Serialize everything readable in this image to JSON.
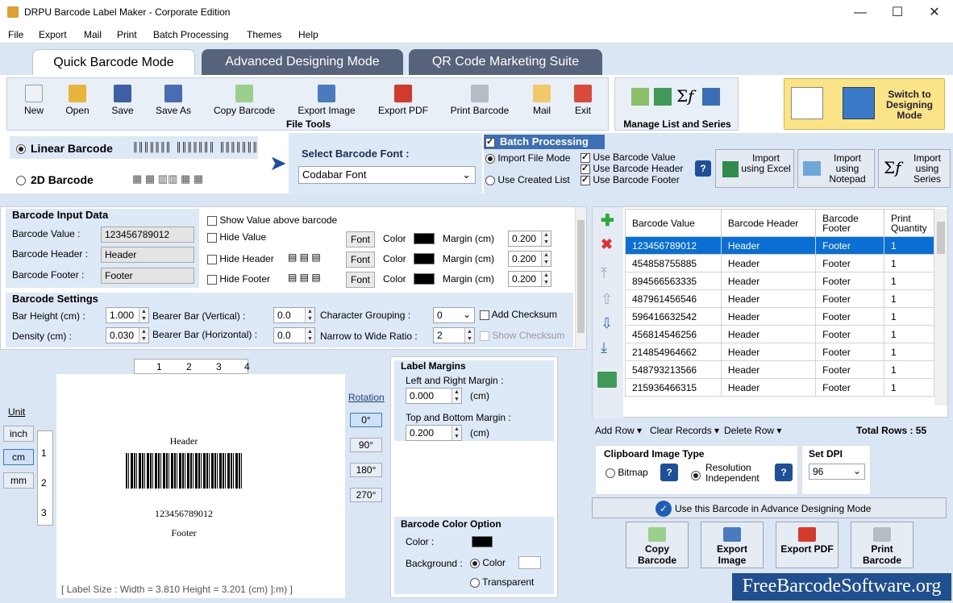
{
  "window": {
    "title": "DRPU Barcode Label Maker - Corporate Edition",
    "min": "—",
    "max": "☐",
    "close": "✕"
  },
  "menu": [
    "File",
    "Export",
    "Mail",
    "Print",
    "Batch Processing",
    "Themes",
    "Help"
  ],
  "tabs": [
    "Quick Barcode Mode",
    "Advanced Designing Mode",
    "QR Code Marketing Suite"
  ],
  "toolbar": {
    "buttons": [
      "New",
      "Open",
      "Save",
      "Save As",
      "Copy Barcode",
      "Export Image",
      "Export PDF",
      "Print Barcode",
      "Mail",
      "Exit"
    ],
    "group_label": "File Tools",
    "manage_label": "Manage List and Series",
    "switch_label": "Switch to Designing Mode"
  },
  "barcode_type": {
    "linear": "Linear Barcode",
    "twod": "2D Barcode",
    "select_font_label": "Select Barcode Font :",
    "font_value": "Codabar Font"
  },
  "batch": {
    "title": "Batch Processing",
    "import_file_mode": "Import File Mode",
    "use_created_list": "Use Created List",
    "use_value": "Use Barcode Value",
    "use_header": "Use Barcode Header",
    "use_footer": "Use Barcode Footer",
    "import_excel": "Import using Excel",
    "import_notepad": "Import using Notepad",
    "import_series": "Import using Series"
  },
  "input_data": {
    "title": "Barcode Input Data",
    "value_label": "Barcode Value :",
    "value": "123456789012",
    "header_label": "Barcode Header :",
    "header": "Header",
    "footer_label": "Barcode Footer :",
    "footer": "Footer",
    "show_value_above": "Show Value above barcode",
    "hide_value": "Hide Value",
    "hide_header": "Hide Header",
    "hide_footer": "Hide Footer",
    "font": "Font",
    "color": "Color",
    "margin": "Margin (cm)",
    "m1": "0.200",
    "m2": "0.200",
    "m3": "0.200"
  },
  "settings": {
    "title": "Barcode Settings",
    "bar_height_label": "Bar Height (cm) :",
    "bar_height": "1.000",
    "density_label": "Density (cm) :",
    "density": "0.030",
    "bearer_v_label": "Bearer Bar (Vertical) :",
    "bearer_v": "0.0",
    "bearer_h_label": "Bearer Bar (Horizontal) :",
    "bearer_h": "0.0",
    "char_group_label": "Character Grouping :",
    "char_group": "0",
    "ratio_label": "Narrow to Wide Ratio :",
    "ratio": "2",
    "add_checksum": "Add Checksum",
    "show_checksum": "Show Checksum"
  },
  "preview": {
    "unit": "Unit",
    "inch": "inch",
    "cm": "cm",
    "mm": "mm",
    "ruler_top": [
      "1",
      "2",
      "3",
      "4"
    ],
    "ruler_left": [
      "1",
      "2",
      "3"
    ],
    "header": "Header",
    "value": "123456789012",
    "footer": "Footer",
    "rotation": "Rotation",
    "rot": [
      "0°",
      "90°",
      "180°",
      "270°"
    ],
    "label_size": "[ Label Size : Width = 3.810  Height = 3.201 (cm) ]:m) ]"
  },
  "margins": {
    "title": "Label Margins",
    "lr_label": "Left and Right Margin :",
    "lr": "0.000",
    "tb_label": "Top and Bottom Margin :",
    "tb": "0.200",
    "unit": "(cm)"
  },
  "color_option": {
    "title": "Barcode Color Option",
    "color_label": "Color :",
    "bg_label": "Background :",
    "color": "Color",
    "transparent": "Transparent"
  },
  "grid": {
    "columns": [
      "Barcode Value",
      "Barcode Header",
      "Barcode Footer",
      "Print Quantity"
    ],
    "rows": [
      [
        "123456789012",
        "Header",
        "Footer",
        "1"
      ],
      [
        "454858755885",
        "Header",
        "Footer",
        "1"
      ],
      [
        "894566563335",
        "Header",
        "Footer",
        "1"
      ],
      [
        "487961456546",
        "Header",
        "Footer",
        "1"
      ],
      [
        "596416632542",
        "Header",
        "Footer",
        "1"
      ],
      [
        "456814546256",
        "Header",
        "Footer",
        "1"
      ],
      [
        "214854964662",
        "Header",
        "Footer",
        "1"
      ],
      [
        "548793213566",
        "Header",
        "Footer",
        "1"
      ],
      [
        "215936466315",
        "Header",
        "Footer",
        "1"
      ]
    ],
    "add_row": "Add Row",
    "clear_records": "Clear Records",
    "delete_row": "Delete Row",
    "total_rows": "Total Rows : 55"
  },
  "clipboard": {
    "title": "Clipboard Image Type",
    "bitmap": "Bitmap",
    "resolution": "Resolution Independent",
    "dpi_label": "Set DPI",
    "dpi": "96"
  },
  "advance_btn": "Use this Barcode in Advance Designing Mode",
  "bottom_buttons": [
    "Copy Barcode",
    "Export Image",
    "Export PDF",
    "Print Barcode"
  ],
  "watermark": "FreeBarcodeSoftware.org"
}
